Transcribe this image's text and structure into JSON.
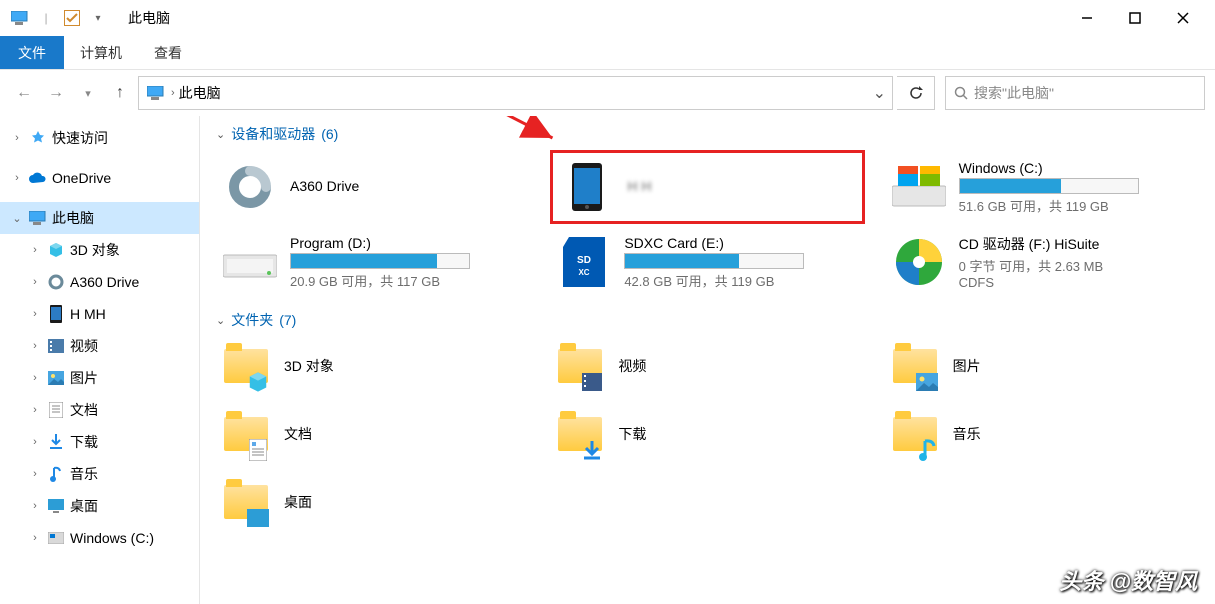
{
  "title": "此电脑",
  "ribbon": {
    "file": "文件",
    "computer": "计算机",
    "view": "查看"
  },
  "breadcrumb": {
    "location": "此电脑"
  },
  "search": {
    "placeholder": "搜索\"此电脑\""
  },
  "sidebar": {
    "quick_access": "快速访问",
    "onedrive": "OneDrive",
    "this_pc": "此电脑",
    "objects3d": "3D 对象",
    "a360": "A360 Drive",
    "phone": "H            MH",
    "videos": "视频",
    "pictures": "图片",
    "documents": "文档",
    "downloads": "下载",
    "music": "音乐",
    "desktop": "桌面",
    "windows_c": "Windows (C:)"
  },
  "sections": {
    "devices": {
      "label": "设备和驱动器",
      "count": "(6)"
    },
    "folders": {
      "label": "文件夹",
      "count": "(7)"
    }
  },
  "devices": {
    "a360": {
      "name": "A360 Drive"
    },
    "phone": {
      "name": "H                H"
    },
    "windows_c": {
      "name": "Windows (C:)",
      "free": "51.6 GB 可用，共 119 GB",
      "pct": 57
    },
    "program_d": {
      "name": "Program (D:)",
      "free": "20.9 GB 可用，共 117 GB",
      "pct": 82
    },
    "sdxc_e": {
      "name": "SDXC Card (E:)",
      "free": "42.8 GB 可用，共 119 GB",
      "pct": 64
    },
    "cd_f": {
      "name": "CD 驱动器 (F:) HiSuite",
      "free": "0 字节 可用，共 2.63 MB",
      "fs": "CDFS"
    }
  },
  "folders": {
    "objects3d": "3D 对象",
    "videos": "视频",
    "pictures": "图片",
    "documents": "文档",
    "downloads": "下载",
    "music": "音乐",
    "desktop": "桌面"
  },
  "watermark": "头条 @数智风"
}
